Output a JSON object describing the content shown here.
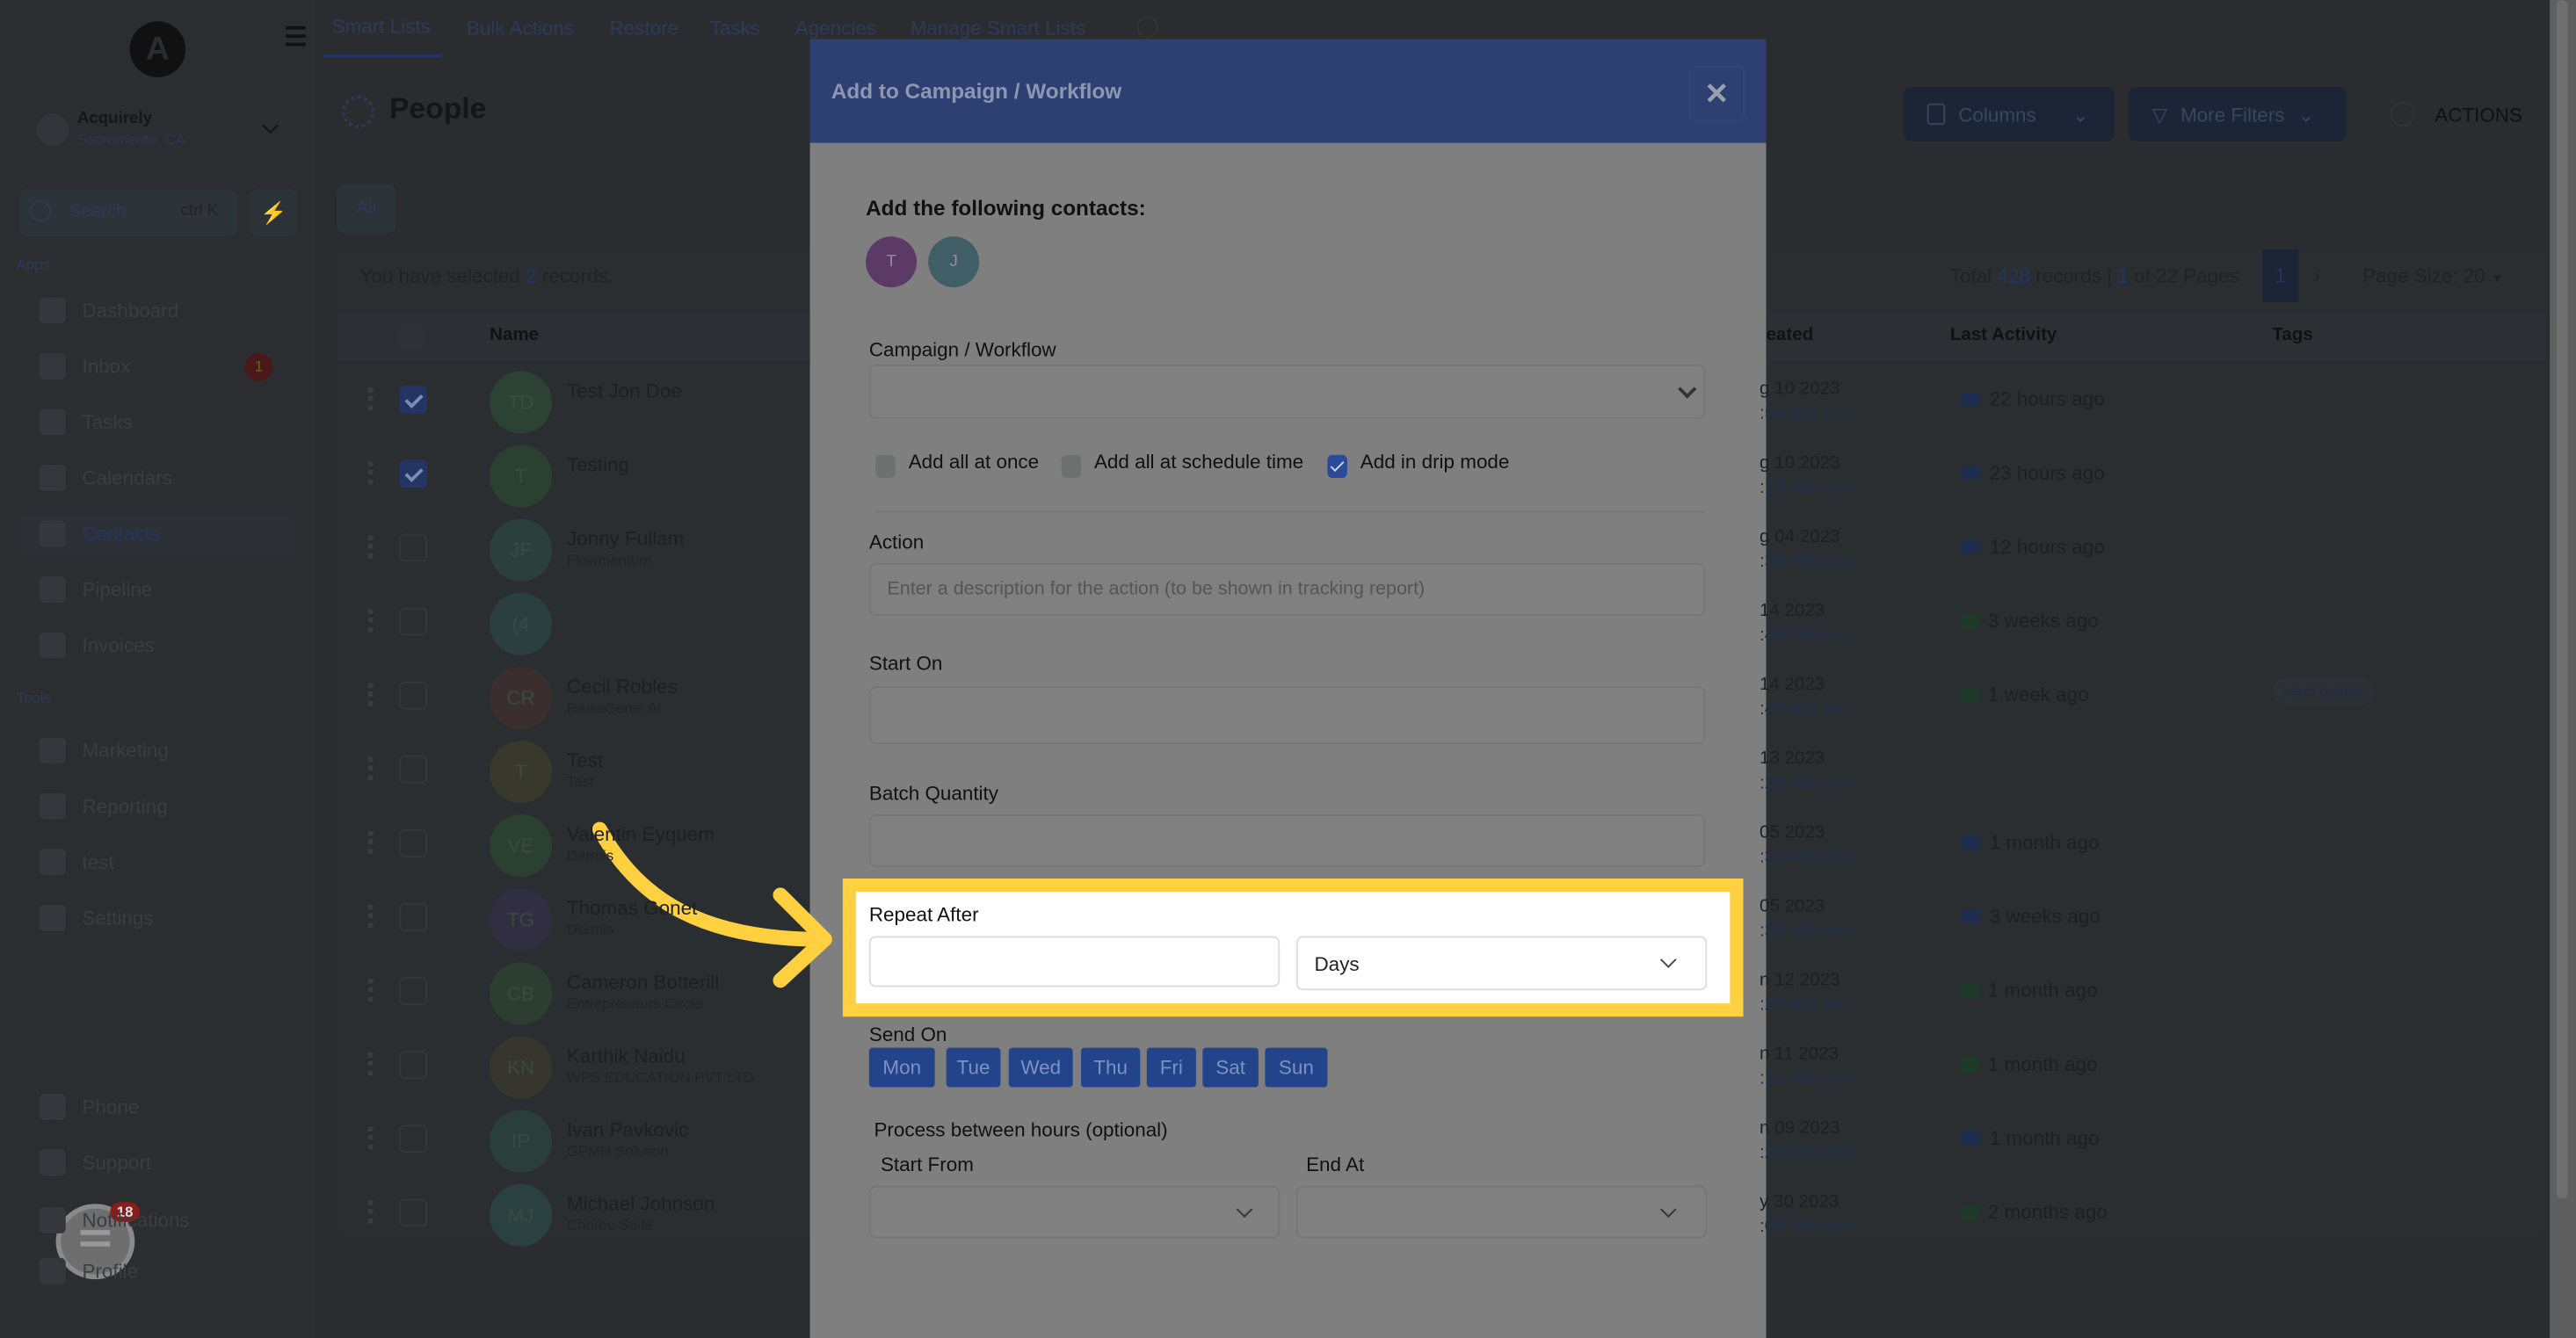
{
  "sidebar": {
    "account_name": "Acquirely",
    "account_location": "Sacramento, CA",
    "search_placeholder": "Search",
    "search_shortcut": "ctrl K",
    "apps_label": "Apps",
    "tools_label": "Tools",
    "apps": [
      {
        "label": "Dashboard"
      },
      {
        "label": "Inbox",
        "badge": "1"
      },
      {
        "label": "Tasks"
      },
      {
        "label": "Calendars"
      },
      {
        "label": "Contacts"
      },
      {
        "label": "Pipeline"
      },
      {
        "label": "Invoices"
      }
    ],
    "tools": [
      {
        "label": "Marketing"
      },
      {
        "label": "Reporting"
      },
      {
        "label": "test"
      },
      {
        "label": "Settings"
      }
    ],
    "bottom": [
      {
        "label": "Phone"
      },
      {
        "label": "Support"
      },
      {
        "label": "Notifications"
      },
      {
        "label": "Profile"
      }
    ],
    "chat_badge": "18"
  },
  "top_tabs": [
    "Smart Lists",
    "Bulk Actions",
    "Restore",
    "Tasks",
    "Agencies",
    "Manage Smart Lists"
  ],
  "page": {
    "title": "People",
    "filter_tab": "All",
    "selected_prefix": "You have selected ",
    "selected_count": "2",
    "selected_suffix": " records.",
    "columns_button": "Columns",
    "filters_button": "More Filters",
    "actions_button": "ACTIONS",
    "total_prefix": "Total ",
    "total_count": "428",
    "total_mid": " records | ",
    "current_page": "1",
    "total_suffix": " of 22 Pages",
    "page_size": "Page Size: 20"
  },
  "table": {
    "headers": [
      "Name",
      "eated",
      "Last Activity",
      "Tags"
    ],
    "rows": [
      {
        "initials": "TD",
        "name": "Test Jon Doe",
        "company": "",
        "date": "g 10 2023",
        "time": ":55 AM",
        "tz": "(PDT)",
        "activity_icon": "email",
        "activity": "22 hours ago",
        "tag": "",
        "checked": true,
        "color": "#2c4234"
      },
      {
        "initials": "T",
        "name": "Testing",
        "company": "",
        "date": "g 10 2023",
        "time": ":19 AM",
        "tz": "(PDT)",
        "activity_icon": "email",
        "activity": "23 hours ago",
        "tag": "",
        "checked": true,
        "color": "#2c4032"
      },
      {
        "initials": "JF",
        "name": "Jonny Fullam",
        "company": "Flowmentum",
        "date": "g 04 2023",
        "time": ":38 PM",
        "tz": "(PDT)",
        "activity_icon": "email",
        "activity": "12 hours ago",
        "tag": "",
        "checked": false,
        "color": "#2b3f3c"
      },
      {
        "initials": "(4",
        "name": "",
        "company": "",
        "date": " 14 2023",
        "time": ":49 PM",
        "tz": "(PDT)",
        "activity_icon": "sms",
        "activity": "3 weeks ago",
        "tag": "",
        "checked": false,
        "color": "#2b3f40"
      },
      {
        "initials": "CR",
        "name": "Cecil Robles",
        "company": "RaiseGenie AI",
        "date": " 14 2023",
        "time": ":47 AM",
        "tz": "(PDT)",
        "activity_icon": "sms",
        "activity": "1 week ago",
        "tag": "send review",
        "checked": false,
        "color": "#3a2e2e"
      },
      {
        "initials": "T",
        "name": "Test",
        "company": "Test",
        "date": " 13 2023",
        "time": ":26 AM",
        "tz": "(PDT)",
        "activity_icon": "",
        "activity": "",
        "tag": "",
        "checked": false,
        "color": "#38382c"
      },
      {
        "initials": "VE",
        "name": "Valentin Eyquem",
        "company": "Dermis",
        "date": " 05 2023",
        "time": ":37 AM",
        "tz": "(PDT)",
        "activity_icon": "email",
        "activity": "1 month ago",
        "tag": "",
        "checked": false,
        "color": "#2c4032"
      },
      {
        "initials": "TG",
        "name": "Thomas Gonet",
        "company": "Dermis",
        "date": " 05 2023",
        "time": ":39 AM",
        "tz": "(PDT)",
        "activity_icon": "email",
        "activity": "3 weeks ago",
        "tag": "",
        "checked": false,
        "color": "#302e40"
      },
      {
        "initials": "CB",
        "name": "Cameron Botterill",
        "company": "Entrepreneurs Circle",
        "date": "n 12 2023",
        "time": ":29 AM",
        "tz": "(PDT)",
        "activity_icon": "sms",
        "activity": "1 month ago",
        "tag": "",
        "checked": false,
        "color": "#2c3e30"
      },
      {
        "initials": "KN",
        "name": "Karthik Naidu",
        "company": "WPS EDUCATION PVT LTD",
        "date": "n 11 2023",
        "time": ":14 AM",
        "tz": "(PDT)",
        "activity_icon": "sms",
        "activity": "1 month ago",
        "tag": "",
        "checked": false,
        "color": "#36352e"
      },
      {
        "initials": "IP",
        "name": "Ivan Pavkovic",
        "company": "GPMH Solution",
        "date": "n 09 2023",
        "time": ":26 AM",
        "tz": "(PDT)",
        "activity_icon": "email",
        "activity": "1 month ago",
        "tag": "",
        "checked": false,
        "color": "#2b3f3a"
      },
      {
        "initials": "MJ",
        "name": "Michael Johnson",
        "company": "Choreo Suite",
        "date": "y 30 2023",
        "time": ":08 AM",
        "tz": "(PDT)",
        "activity_icon": "sms",
        "activity": "2 months ago",
        "tag": "",
        "checked": false,
        "color": "#2b4040"
      }
    ]
  },
  "modal": {
    "title": "Add to Campaign / Workflow",
    "contacts_heading": "Add the following contacts:",
    "contacts": [
      {
        "initial": "T",
        "color": "#5c3a66"
      },
      {
        "initial": "J",
        "color": "#3f5e66"
      }
    ],
    "campaign_label": "Campaign / Workflow",
    "campaign_value": "",
    "modes": [
      {
        "label": "Add all at once",
        "checked": false
      },
      {
        "label": "Add all at schedule time",
        "checked": false
      },
      {
        "label": "Add in drip mode",
        "checked": true
      }
    ],
    "action_label": "Action",
    "action_placeholder": "Enter a description for the action (to be shown in tracking report)",
    "start_on_label": "Start On",
    "batch_label": "Batch Quantity",
    "repeat_label": "Repeat After",
    "repeat_value": "",
    "repeat_unit": "Days",
    "send_on_label": "Send On",
    "days": [
      "Mon",
      "Tue",
      "Wed",
      "Thu",
      "Fri",
      "Sat",
      "Sun"
    ],
    "hours_label": "Process between hours (optional)",
    "start_from_label": "Start From",
    "end_at_label": "End At"
  },
  "colors": {
    "highlight": "#ffd040",
    "modal_header": "#2e3f72",
    "day_button": "#23448a"
  }
}
